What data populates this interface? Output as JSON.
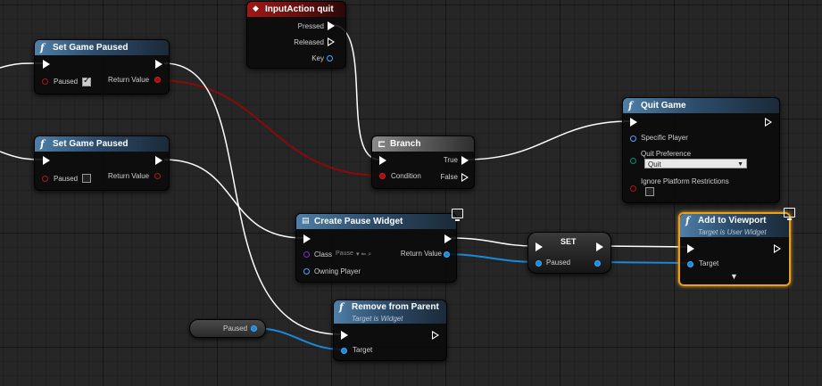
{
  "colors": {
    "exec_wire": "#ffffff",
    "bool_wire": "#8a0a0a",
    "object_wire": "#1a8ad8",
    "selected_border": "#e8a020"
  },
  "nodes": {
    "set_paused_1": {
      "title": "Set Game Paused",
      "pin_paused": "Paused",
      "pin_return": "Return Value",
      "paused_checked": true
    },
    "set_paused_2": {
      "title": "Set Game Paused",
      "pin_paused": "Paused",
      "pin_return": "Return Value",
      "paused_checked": false
    },
    "input_quit": {
      "title": "InputAction quit",
      "pin_pressed": "Pressed",
      "pin_released": "Released",
      "pin_key": "Key"
    },
    "branch": {
      "title": "Branch",
      "pin_condition": "Condition",
      "pin_true": "True",
      "pin_false": "False"
    },
    "quit_game": {
      "title": "Quit Game",
      "pin_player": "Specific Player",
      "pin_pref": "Quit Preference",
      "pref_value": "Quit",
      "pin_ignore": "Ignore Platform Restrictions"
    },
    "create_widget": {
      "title": "Create Pause Widget",
      "pin_class": "Class",
      "class_value": "Pause",
      "pin_owner": "Owning Player",
      "pin_return": "Return Value"
    },
    "set_var": {
      "title": "SET",
      "pin_paused": "Paused"
    },
    "add_viewport": {
      "title": "Add to Viewport",
      "subtitle": "Target is User Widget",
      "pin_target": "Target"
    },
    "remove_parent": {
      "title": "Remove from Parent",
      "subtitle": "Target is Widget",
      "pin_target": "Target"
    },
    "get_paused": {
      "label": "Paused"
    }
  }
}
